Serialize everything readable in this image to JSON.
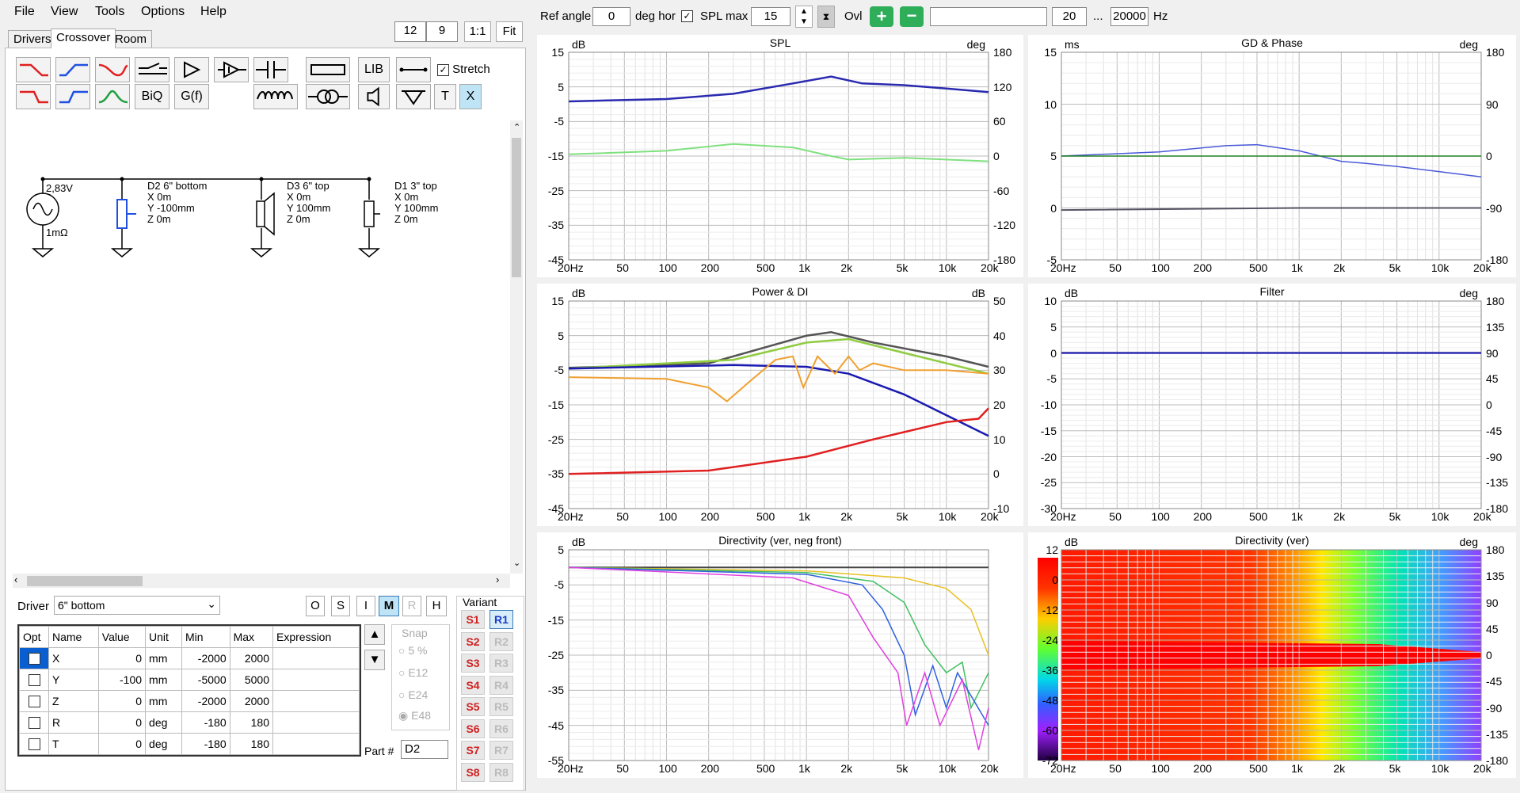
{
  "menu": [
    "File",
    "View",
    "Tools",
    "Options",
    "Help"
  ],
  "tabs": [
    "Drivers",
    "Crossover",
    "Room"
  ],
  "grid_buttons": {
    "cols": "12",
    "rows": "9",
    "one_to_one": "1:1",
    "fit": "Fit"
  },
  "toolbar": {
    "lib": "LIB",
    "biq": "BiQ",
    "gf": "G(f)",
    "t": "T",
    "x": "X",
    "stretch": "Stretch"
  },
  "schematic": {
    "source": {
      "voltage": "2,83V",
      "resistance": "1mΩ"
    },
    "drivers": [
      {
        "name": "D2 6\" bottom",
        "x": "X 0m",
        "y": "Y -100mm",
        "z": "Z 0m"
      },
      {
        "name": "D3 6\" top",
        "x": "X 0m",
        "y": "Y 100mm",
        "z": "Z 0m"
      },
      {
        "name": "D1 3\" top",
        "x": "X 0m",
        "y": "Y 100mm",
        "z": "Z 0m"
      }
    ]
  },
  "driver_select": {
    "label": "Driver",
    "value": "6\" bottom"
  },
  "mode_buttons": [
    "O",
    "S",
    "I",
    "M",
    "R",
    "H"
  ],
  "params": {
    "headers": [
      "Opt",
      "Name",
      "Value",
      "Unit",
      "Min",
      "Max",
      "Expression"
    ],
    "rows": [
      {
        "name": "X",
        "value": "0",
        "unit": "mm",
        "min": "-2000",
        "max": "2000"
      },
      {
        "name": "Y",
        "value": "-100",
        "unit": "mm",
        "min": "-5000",
        "max": "5000"
      },
      {
        "name": "Z",
        "value": "0",
        "unit": "mm",
        "min": "-2000",
        "max": "2000"
      },
      {
        "name": "R",
        "value": "0",
        "unit": "deg",
        "min": "-180",
        "max": "180"
      },
      {
        "name": "T",
        "value": "0",
        "unit": "deg",
        "min": "-180",
        "max": "180"
      }
    ]
  },
  "snap": {
    "label": "Snap",
    "options": [
      "5 %",
      "E12",
      "E24",
      "E48"
    ]
  },
  "part": {
    "label": "Part #",
    "value": "D2"
  },
  "variant": {
    "label": "Variant",
    "s": [
      "S1",
      "S2",
      "S3",
      "S4",
      "S5",
      "S6",
      "S7",
      "S8"
    ],
    "r": [
      "R1",
      "R2",
      "R3",
      "R4",
      "R5",
      "R6",
      "R7",
      "R8"
    ]
  },
  "topbar": {
    "ref_angle_label": "Ref angle",
    "ref_angle": "0",
    "deg_hor": "deg hor",
    "spl_max_label": "SPL max",
    "spl_max": "15",
    "ovl": "Ovl",
    "f_min": "20",
    "dots": "...",
    "f_max": "20000",
    "hz": "Hz"
  },
  "colors": {
    "accent": "#2eae59",
    "blue_btn": "#1a3cc8",
    "red_btn": "#d02020"
  },
  "xticks": [
    "20Hz",
    "50",
    "100",
    "200",
    "500",
    "1k",
    "2k",
    "5k",
    "10k",
    "20k"
  ],
  "graphs": {
    "spl": {
      "title": "SPL",
      "lunit": "dB",
      "runit": "deg",
      "left": [
        "15",
        "5",
        "-5",
        "-15",
        "-25",
        "-35",
        "-45"
      ],
      "right": [
        "180",
        "120",
        "60",
        "0",
        "-60",
        "-120",
        "-180"
      ]
    },
    "gd": {
      "title": "GD & Phase",
      "lunit": "ms",
      "runit": "deg",
      "left": [
        "15",
        "10",
        "5",
        "0",
        "-5"
      ],
      "right": [
        "180",
        "90",
        "0",
        "-90",
        "-180"
      ]
    },
    "power": {
      "title": "Power & DI",
      "lunit": "dB",
      "runit": "dB",
      "left": [
        "15",
        "5",
        "-5",
        "-15",
        "-25",
        "-35",
        "-45"
      ],
      "right": [
        "50",
        "40",
        "30",
        "20",
        "10",
        "0",
        "-10"
      ]
    },
    "filter": {
      "title": "Filter",
      "lunit": "dB",
      "runit": "deg",
      "left": [
        "10",
        "5",
        "0",
        "-5",
        "-10",
        "-15",
        "-20",
        "-25",
        "-30"
      ],
      "right": [
        "180",
        "135",
        "90",
        "45",
        "0",
        "-45",
        "-90",
        "-135",
        "-180"
      ]
    },
    "dir": {
      "title": "Directivity (ver, neg front)",
      "lunit": "dB",
      "left": [
        "5",
        "-5",
        "-15",
        "-25",
        "-35",
        "-45",
        "-55"
      ]
    },
    "dirmap": {
      "title": "Directivity (ver)",
      "lunit": "dB",
      "runit": "deg",
      "left": [
        "12",
        "0",
        "-12",
        "-24",
        "-36",
        "-48",
        "-60",
        "-72"
      ],
      "right": [
        "180",
        "135",
        "90",
        "45",
        "0",
        "-45",
        "-90",
        "-135",
        "-180"
      ]
    }
  }
}
